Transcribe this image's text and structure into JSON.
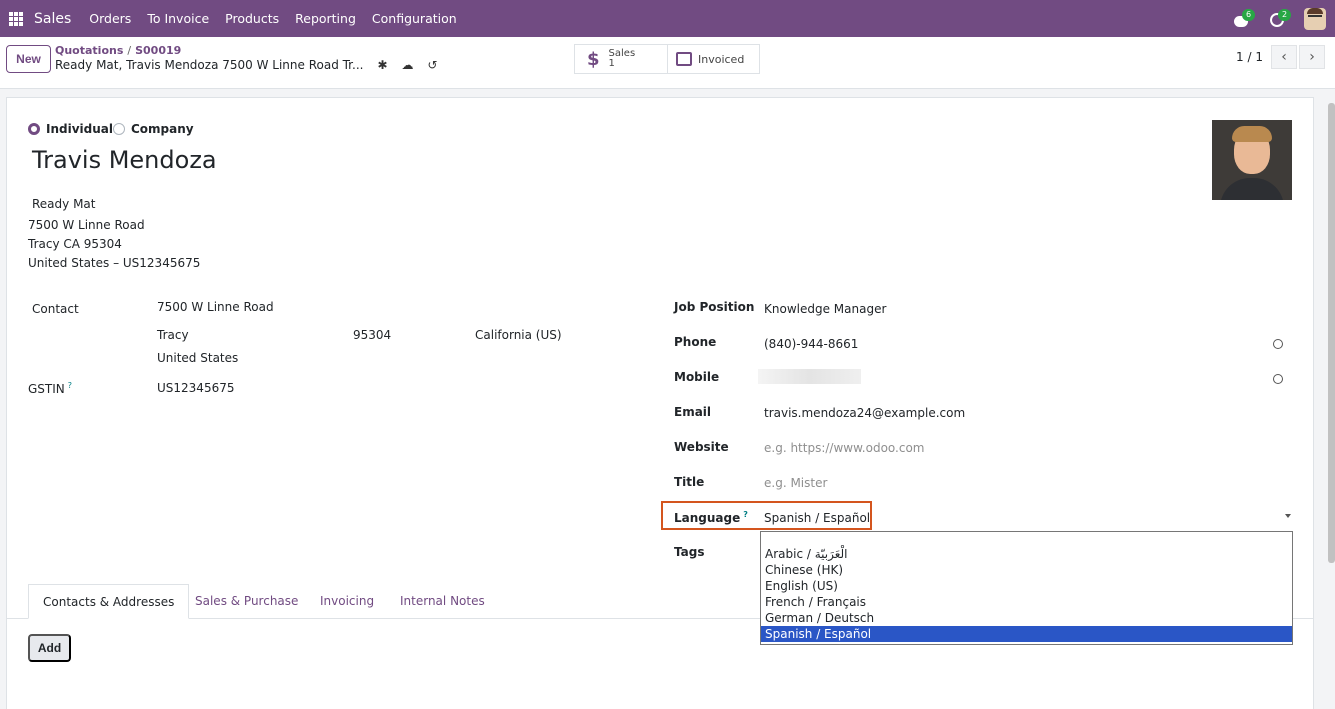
{
  "nav": {
    "brand": "Sales",
    "items": [
      "Orders",
      "To Invoice",
      "Products",
      "Reporting",
      "Configuration"
    ],
    "chat_badge": "6",
    "activity_badge": "2"
  },
  "control": {
    "new_label": "New",
    "breadcrumb_parent": "Quotations",
    "breadcrumb_separator": "/",
    "breadcrumb_record": "S00019",
    "record_title": "Ready Mat, Travis Mendoza 7500 W Linne Road Tr...",
    "smart_sales_label": "Sales",
    "smart_sales_count": "1",
    "smart_invoiced_label": "Invoiced",
    "pager": "1 / 1"
  },
  "form": {
    "type_individual": "Individual",
    "type_company": "Company",
    "name": "Travis Mendoza",
    "address": {
      "company": "Ready Mat",
      "street": "7500 W Linne Road",
      "city_line": "Tracy CA 95304",
      "country_line": "United States – US12345675"
    },
    "contact_label": "Contact",
    "contact_street": "7500 W Linne Road",
    "contact_city": "Tracy",
    "contact_zip": "95304",
    "contact_state": "California (US)",
    "contact_country": "United States",
    "gstin_label": "GSTIN",
    "gstin_value": "US12345675",
    "job_position_label": "Job Position",
    "job_position_value": "Knowledge Manager",
    "phone_label": "Phone",
    "phone_value": "(840)-944-8661",
    "mobile_label": "Mobile",
    "email_label": "Email",
    "email_value": "travis.mendoza24@example.com",
    "website_label": "Website",
    "website_placeholder": "e.g. https://www.odoo.com",
    "title_label": "Title",
    "title_placeholder": "e.g. Mister",
    "language_label": "Language",
    "language_value": "Spanish / Español",
    "tags_label": "Tags",
    "help_mark": "?"
  },
  "language_options": [
    "Arabic / الْعَرَبيّة",
    "Chinese (HK)",
    "English (US)",
    "French / Français",
    "German / Deutsch",
    "Spanish / Español"
  ],
  "tabs": [
    "Contacts & Addresses",
    "Sales & Purchase",
    "Invoicing",
    "Internal Notes"
  ],
  "add_label": "Add",
  "colors": {
    "brand": "#714b82",
    "highlight": "#d4551e",
    "selected_option": "#2a56c6"
  }
}
